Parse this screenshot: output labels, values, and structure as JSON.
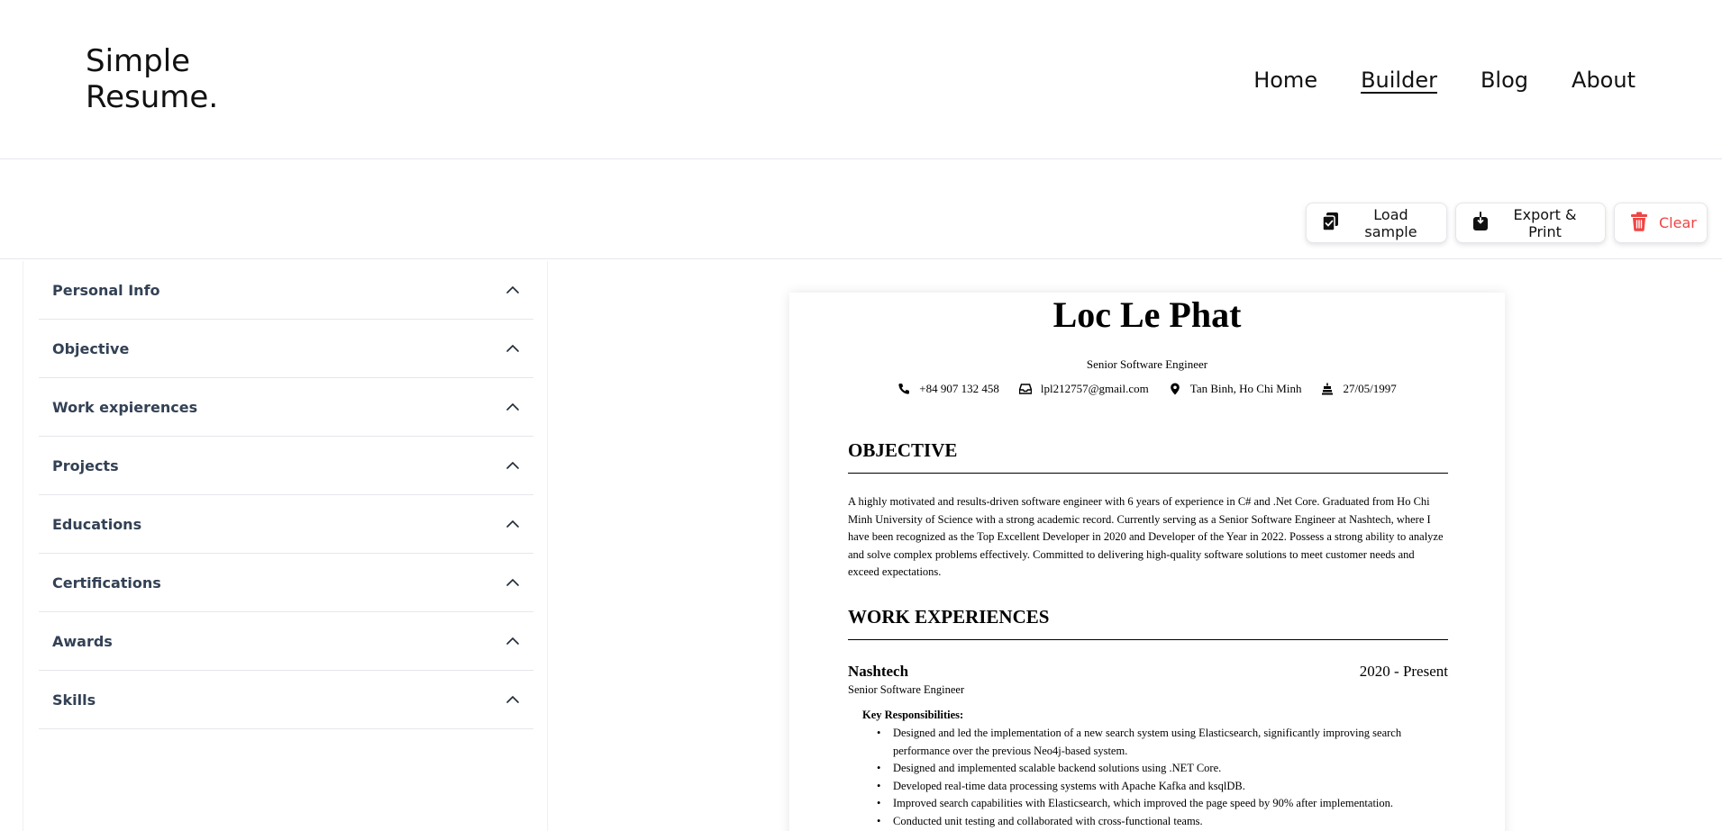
{
  "brand": {
    "line1": "Simple",
    "line2": "Resume."
  },
  "nav": {
    "items": [
      "Home",
      "Builder",
      "Blog",
      "About"
    ],
    "active": "Builder"
  },
  "toolbar": {
    "load_label": "Load sample",
    "export_label": "Export & Print",
    "clear_label": "Clear",
    "clear_color": "#ef4444"
  },
  "sidebar": {
    "sections": [
      "Personal Info",
      "Objective",
      "Work expierences",
      "Projects",
      "Educations",
      "Certifications",
      "Awards",
      "Skills"
    ]
  },
  "resume": {
    "name": "Loc Le Phat",
    "title": "Senior Software Engineer",
    "contacts": {
      "phone": "+84 907 132 458",
      "email": "lpl212757@gmail.com",
      "location": "Tan Binh, Ho Chi Minh",
      "birthday": "27/05/1997"
    },
    "objective_heading": "OBJECTIVE",
    "objective_text": "A highly motivated and results-driven software engineer with 6 years of experience in C# and .Net Core. Graduated from Ho Chi Minh University of Science with a strong academic record. Currently serving as a Senior Software Engineer at Nashtech, where I have been recognized as the Top Excellent Developer in 2020 and Developer of the Year in 2022. Possess a strong ability to analyze and solve complex problems effectively. Committed to delivering high-quality software solutions to meet customer needs and exceed expectations.",
    "work_heading": "WORK EXPERIENCES",
    "job": {
      "company": "Nashtech",
      "period": "2020 - Present",
      "role": "Senior Software Engineer",
      "responsibilities_heading": "Key Responsibilities:",
      "responsibilities": [
        "Designed and led the implementation of a new search system using Elasticsearch, significantly improving search performance over the previous Neo4j-based system.",
        "Designed and implemented scalable backend solutions using .NET Core.",
        "Developed real-time data processing systems with Apache Kafka and ksqlDB.",
        "Improved search capabilities with Elasticsearch, which improved the page speed by 90% after implementation.",
        "Conducted unit testing and collaborated with cross-functional teams."
      ]
    }
  }
}
